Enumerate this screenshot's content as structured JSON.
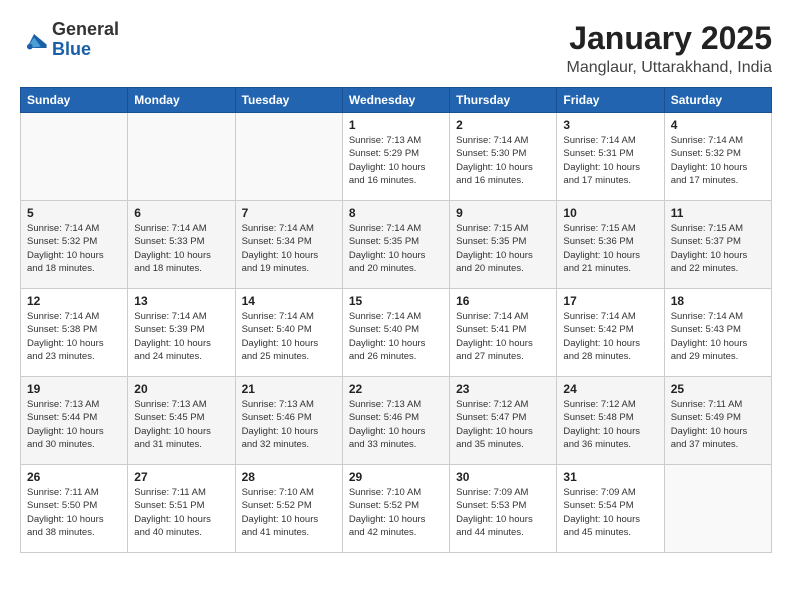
{
  "header": {
    "logo": {
      "general": "General",
      "blue": "Blue"
    },
    "title": "January 2025",
    "location": "Manglaur, Uttarakhand, India"
  },
  "weekdays": [
    "Sunday",
    "Monday",
    "Tuesday",
    "Wednesday",
    "Thursday",
    "Friday",
    "Saturday"
  ],
  "weeks": [
    [
      {
        "day": "",
        "info": ""
      },
      {
        "day": "",
        "info": ""
      },
      {
        "day": "",
        "info": ""
      },
      {
        "day": "1",
        "info": "Sunrise: 7:13 AM\nSunset: 5:29 PM\nDaylight: 10 hours\nand 16 minutes."
      },
      {
        "day": "2",
        "info": "Sunrise: 7:14 AM\nSunset: 5:30 PM\nDaylight: 10 hours\nand 16 minutes."
      },
      {
        "day": "3",
        "info": "Sunrise: 7:14 AM\nSunset: 5:31 PM\nDaylight: 10 hours\nand 17 minutes."
      },
      {
        "day": "4",
        "info": "Sunrise: 7:14 AM\nSunset: 5:32 PM\nDaylight: 10 hours\nand 17 minutes."
      }
    ],
    [
      {
        "day": "5",
        "info": "Sunrise: 7:14 AM\nSunset: 5:32 PM\nDaylight: 10 hours\nand 18 minutes."
      },
      {
        "day": "6",
        "info": "Sunrise: 7:14 AM\nSunset: 5:33 PM\nDaylight: 10 hours\nand 18 minutes."
      },
      {
        "day": "7",
        "info": "Sunrise: 7:14 AM\nSunset: 5:34 PM\nDaylight: 10 hours\nand 19 minutes."
      },
      {
        "day": "8",
        "info": "Sunrise: 7:14 AM\nSunset: 5:35 PM\nDaylight: 10 hours\nand 20 minutes."
      },
      {
        "day": "9",
        "info": "Sunrise: 7:15 AM\nSunset: 5:35 PM\nDaylight: 10 hours\nand 20 minutes."
      },
      {
        "day": "10",
        "info": "Sunrise: 7:15 AM\nSunset: 5:36 PM\nDaylight: 10 hours\nand 21 minutes."
      },
      {
        "day": "11",
        "info": "Sunrise: 7:15 AM\nSunset: 5:37 PM\nDaylight: 10 hours\nand 22 minutes."
      }
    ],
    [
      {
        "day": "12",
        "info": "Sunrise: 7:14 AM\nSunset: 5:38 PM\nDaylight: 10 hours\nand 23 minutes."
      },
      {
        "day": "13",
        "info": "Sunrise: 7:14 AM\nSunset: 5:39 PM\nDaylight: 10 hours\nand 24 minutes."
      },
      {
        "day": "14",
        "info": "Sunrise: 7:14 AM\nSunset: 5:40 PM\nDaylight: 10 hours\nand 25 minutes."
      },
      {
        "day": "15",
        "info": "Sunrise: 7:14 AM\nSunset: 5:40 PM\nDaylight: 10 hours\nand 26 minutes."
      },
      {
        "day": "16",
        "info": "Sunrise: 7:14 AM\nSunset: 5:41 PM\nDaylight: 10 hours\nand 27 minutes."
      },
      {
        "day": "17",
        "info": "Sunrise: 7:14 AM\nSunset: 5:42 PM\nDaylight: 10 hours\nand 28 minutes."
      },
      {
        "day": "18",
        "info": "Sunrise: 7:14 AM\nSunset: 5:43 PM\nDaylight: 10 hours\nand 29 minutes."
      }
    ],
    [
      {
        "day": "19",
        "info": "Sunrise: 7:13 AM\nSunset: 5:44 PM\nDaylight: 10 hours\nand 30 minutes."
      },
      {
        "day": "20",
        "info": "Sunrise: 7:13 AM\nSunset: 5:45 PM\nDaylight: 10 hours\nand 31 minutes."
      },
      {
        "day": "21",
        "info": "Sunrise: 7:13 AM\nSunset: 5:46 PM\nDaylight: 10 hours\nand 32 minutes."
      },
      {
        "day": "22",
        "info": "Sunrise: 7:13 AM\nSunset: 5:46 PM\nDaylight: 10 hours\nand 33 minutes."
      },
      {
        "day": "23",
        "info": "Sunrise: 7:12 AM\nSunset: 5:47 PM\nDaylight: 10 hours\nand 35 minutes."
      },
      {
        "day": "24",
        "info": "Sunrise: 7:12 AM\nSunset: 5:48 PM\nDaylight: 10 hours\nand 36 minutes."
      },
      {
        "day": "25",
        "info": "Sunrise: 7:11 AM\nSunset: 5:49 PM\nDaylight: 10 hours\nand 37 minutes."
      }
    ],
    [
      {
        "day": "26",
        "info": "Sunrise: 7:11 AM\nSunset: 5:50 PM\nDaylight: 10 hours\nand 38 minutes."
      },
      {
        "day": "27",
        "info": "Sunrise: 7:11 AM\nSunset: 5:51 PM\nDaylight: 10 hours\nand 40 minutes."
      },
      {
        "day": "28",
        "info": "Sunrise: 7:10 AM\nSunset: 5:52 PM\nDaylight: 10 hours\nand 41 minutes."
      },
      {
        "day": "29",
        "info": "Sunrise: 7:10 AM\nSunset: 5:52 PM\nDaylight: 10 hours\nand 42 minutes."
      },
      {
        "day": "30",
        "info": "Sunrise: 7:09 AM\nSunset: 5:53 PM\nDaylight: 10 hours\nand 44 minutes."
      },
      {
        "day": "31",
        "info": "Sunrise: 7:09 AM\nSunset: 5:54 PM\nDaylight: 10 hours\nand 45 minutes."
      },
      {
        "day": "",
        "info": ""
      }
    ]
  ],
  "colors": {
    "header_bg": "#2264b0",
    "header_text": "#ffffff"
  }
}
